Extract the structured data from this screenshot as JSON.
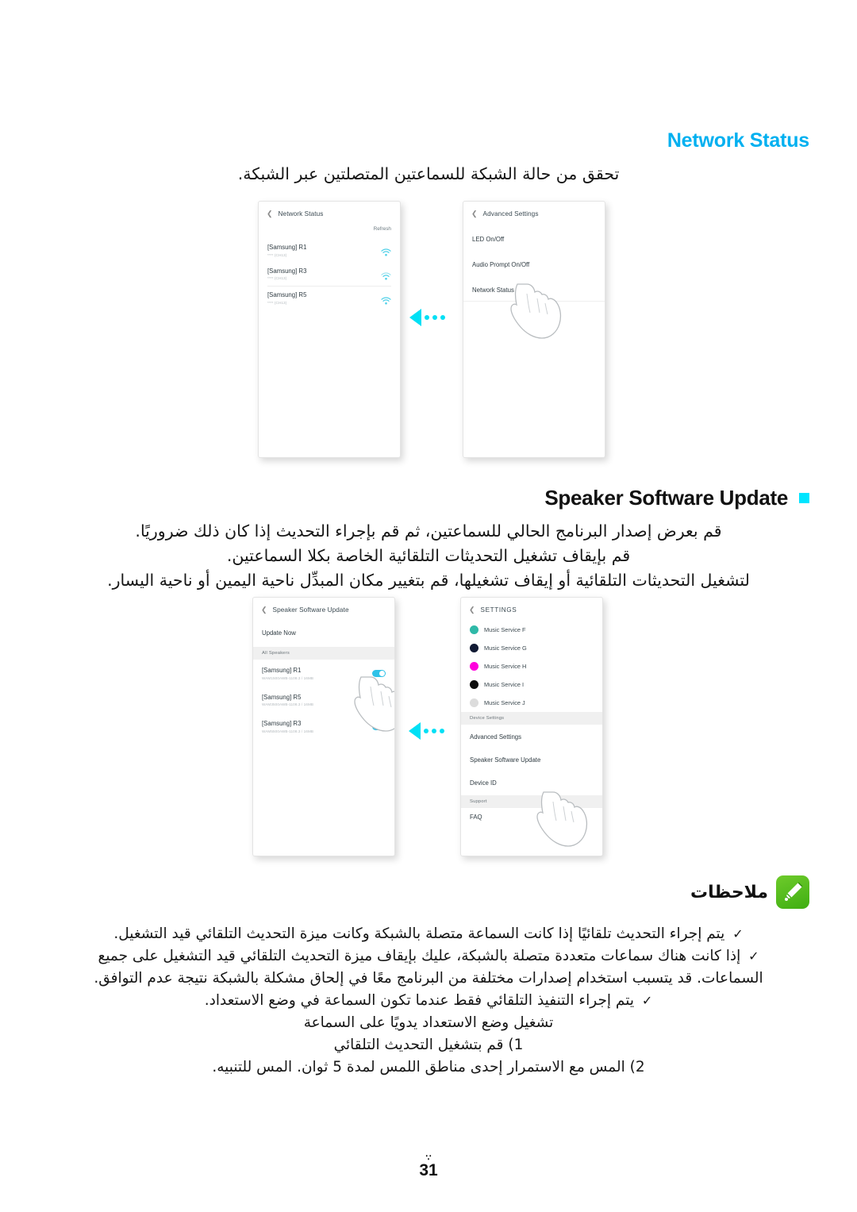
{
  "sections": {
    "network_status": {
      "title": "Network Status",
      "description": "تحقق من حالة الشبكة للسماعتين المتصلتين عبر الشبكة."
    },
    "speaker_software_update": {
      "title": "Speaker Software Update",
      "lines": [
        "قم بعرض إصدار البرنامج الحالي للسماعتين، ثم قم بإجراء التحديث إذا كان ذلك ضروريًا.",
        "قم بإيقاف تشغيل التحديثات التلقائية الخاصة بكلا السماعتين.",
        "لتشغيل التحديثات التلقائية أو إيقاف تشغيلها، قم بتغيير مكان المبدِّل ناحية اليمين أو ناحية اليسار."
      ]
    }
  },
  "mockups": {
    "network_status_screen": {
      "back_icon": "chevron-left-icon",
      "title": "Network Status",
      "refresh_label": "Refresh",
      "speakers": [
        {
          "name": "[Samsung] R1",
          "detail": "**** (CH13)",
          "icon": "wifi-icon"
        },
        {
          "name": "[Samsung] R3",
          "detail": "**** (CH13)",
          "icon": "wifi-icon"
        },
        {
          "name": "[Samsung] R5",
          "detail": "**** (CH13)",
          "icon": "wifi-icon"
        }
      ]
    },
    "advanced_settings_screen": {
      "back_icon": "chevron-left-icon",
      "title": "Advanced Settings",
      "items": [
        "LED On/Off",
        "Audio Prompt On/Off",
        "Network Status"
      ],
      "tapped_item": "Network Status"
    },
    "software_update_screen": {
      "back_icon": "chevron-left-icon",
      "title": "Speaker Software Update",
      "update_now_label": "Update Now",
      "group_label": "All Speakers",
      "speakers": [
        {
          "name": "[Samsung] R1",
          "version": "WAM1500AWB-1108.3 / 16MB",
          "toggle": "on"
        },
        {
          "name": "[Samsung] R5",
          "version": "WAM3500AWB-1108.3 / 16MB",
          "toggle": "on"
        },
        {
          "name": "[Samsung] R3",
          "version": "WAM5500AWB-1108.3 / 16MB",
          "toggle": "on"
        }
      ]
    },
    "settings_screen": {
      "back_icon": "chevron-left-icon",
      "title": "SETTINGS",
      "services": [
        {
          "label": "Music Service F",
          "color": "#2fb9a8"
        },
        {
          "label": "Music Service G",
          "color": "#111a34"
        },
        {
          "label": "Music Service H",
          "color": "#ff00dd"
        },
        {
          "label": "Music Service I",
          "color": "#0d0d0d"
        },
        {
          "label": "Music Service J",
          "color": "#dcdcdc"
        }
      ],
      "device_settings_group": "Device Settings",
      "device_items": [
        "Advanced Settings",
        "Speaker Software Update",
        "Device ID"
      ],
      "support_group": "Support",
      "support_items": [
        "FAQ"
      ],
      "tapped_item": "Speaker Software Update"
    },
    "flow_arrow_icon": "arrow-left-flow-icon"
  },
  "notes": {
    "heading": "ملاحظات",
    "heading_icon": "pencil-note-icon",
    "bullet_mark": "✓",
    "items": [
      "يتم إجراء التحديث تلقائيًا إذا كانت السماعة متصلة بالشبكة وكانت ميزة التحديث التلقائي قيد التشغيل.",
      "إذا كانت هناك سماعات متعددة متصلة بالشبكة، عليك بإيقاف ميزة التحديث التلقائي قيد التشغيل على جميع",
      "السماعات. قد يتسبب استخدام إصدارات مختلفة من البرنامج معًا في إلحاق مشكلة بالشبكة نتيجة عدم التوافق.",
      "يتم إجراء التنفيذ التلقائي فقط عندما تكون السماعة في وضع الاستعداد."
    ],
    "procedure": {
      "title": "تشغيل وضع الاستعداد يدويًا على السماعة",
      "steps": [
        "1) قم بتشغيل التحديث التلقائي",
        "2) المس مع الاستمرار إحدى مناطق اللمس لمدة 5 ثوان. المس للتنبيه."
      ]
    }
  },
  "footer": {
    "page_number": "31",
    "ornament": "∵"
  },
  "colors": {
    "accent_cyan": "#00b0f0",
    "bullet_cyan": "#00e5ff",
    "toggle_on": "#2fc2e8",
    "note_green": "#57bd1f"
  }
}
